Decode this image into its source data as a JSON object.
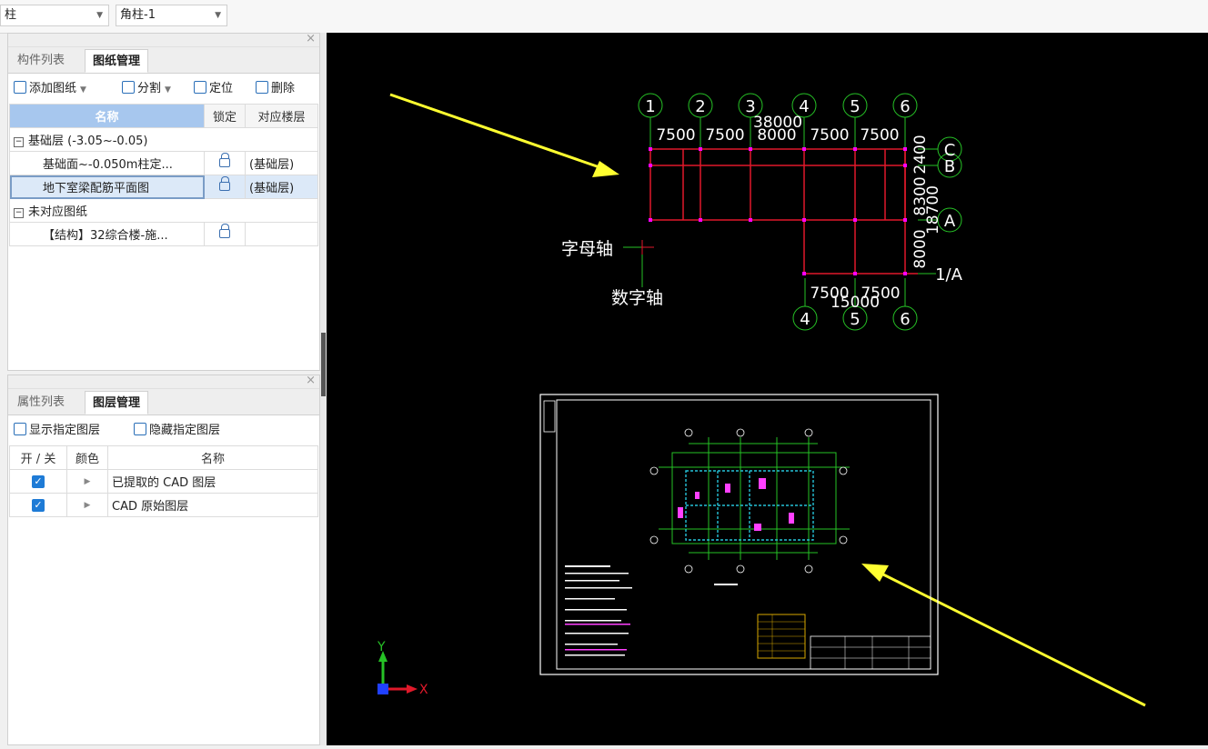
{
  "top": {
    "combo1": "柱",
    "combo2": "角柱-1"
  },
  "drawing_panel": {
    "tabs": [
      "构件列表",
      "图纸管理"
    ],
    "toolbar": {
      "add": "添加图纸",
      "split": "分割",
      "locate": "定位",
      "delete": "删除"
    },
    "columns": {
      "name": "名称",
      "lock": "锁定",
      "floor": "对应楼层"
    },
    "rows": [
      {
        "name": "基础层 (-3.05~-0.05)",
        "floor": ""
      },
      {
        "name": "基础面~-0.050m柱定...",
        "floor": "(基础层)"
      },
      {
        "name": "地下室梁配筋平面图",
        "floor": "(基础层)"
      },
      {
        "name": "未对应图纸",
        "floor": ""
      },
      {
        "name": "【结构】32综合楼-施...",
        "floor": ""
      }
    ]
  },
  "layer_panel": {
    "tabs": [
      "属性列表",
      "图层管理"
    ],
    "toolbar": {
      "show": "显示指定图层",
      "hide": "隐藏指定图层"
    },
    "columns": {
      "toggle": "开 / 关",
      "color": "颜色",
      "name": "名称"
    },
    "rows": [
      {
        "name": "已提取的 CAD 图层",
        "on": true
      },
      {
        "name": "CAD 原始图层",
        "on": true
      }
    ]
  },
  "cad": {
    "axes_top": [
      "1",
      "2",
      "3",
      "4",
      "5",
      "6"
    ],
    "axes_bottom": [
      "4",
      "5",
      "6"
    ],
    "axes_right": [
      "C",
      "B",
      "A",
      "1/A"
    ],
    "dims_top": [
      "7500",
      "7500",
      "8000",
      "7500",
      "7500"
    ],
    "dim_total_top": "38000",
    "dims_bottom": [
      "7500",
      "7500"
    ],
    "dim_total_bottom": "15000",
    "dims_right": [
      "2400",
      "8300",
      "8000"
    ],
    "dim_total_right": "18700",
    "letter_axis": "字母轴",
    "number_axis": "数字轴",
    "ucs_x": "X",
    "ucs_y": "Y",
    "colors": {
      "grid": "#e0192a",
      "bubble": "#26c226",
      "arrow": "#ffff30",
      "text": "#ffffff"
    }
  }
}
